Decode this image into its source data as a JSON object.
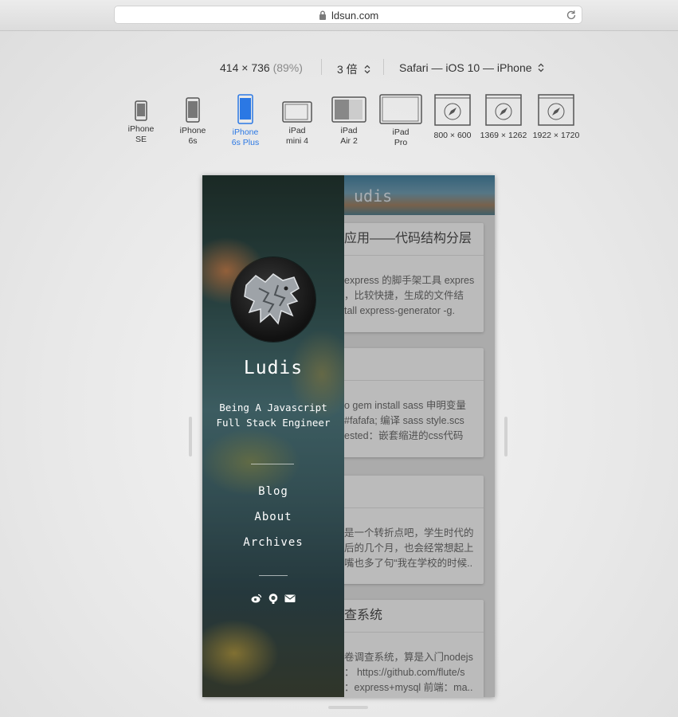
{
  "browser": {
    "url": "ldsun.com"
  },
  "responsive": {
    "dimensions": "414 × 736",
    "zoom_pct": "(89%)",
    "scale": "3 倍",
    "browser_label": "Safari — iOS 10 — iPhone",
    "devices": [
      {
        "line1": "iPhone",
        "line2": "SE",
        "icon": "phone-icon"
      },
      {
        "line1": "iPhone",
        "line2": "6s",
        "icon": "phone-icon"
      },
      {
        "line1": "iPhone",
        "line2": "6s Plus",
        "icon": "phone-icon",
        "active": true
      },
      {
        "line1": "iPad",
        "line2": "mini 4",
        "icon": "tablet-icon"
      },
      {
        "line1": "iPad",
        "line2": "Air 2",
        "icon": "tablet-icon"
      },
      {
        "line1": "iPad",
        "line2": "Pro",
        "icon": "tablet-icon"
      },
      {
        "line1": "800 × 600",
        "line2": "",
        "icon": "compass-icon"
      },
      {
        "line1": "1369 × 1262",
        "line2": "",
        "icon": "compass-icon"
      },
      {
        "line1": "1922 × 1720",
        "line2": "",
        "icon": "compass-icon"
      }
    ],
    "accent_color": "#2b78e4"
  },
  "site": {
    "header_title": "udis",
    "sidebar": {
      "name": "Ludis",
      "tagline": "Being A Javascript Full Stack Engineer",
      "nav": [
        "Blog",
        "About",
        "Archives"
      ],
      "social_icons": [
        "weibo-icon",
        "github-icon",
        "mail-icon"
      ]
    },
    "posts": [
      {
        "title": "应用——代码结构分层",
        "lines": [
          "express 的脚手架工具 expres",
          "，比较快捷，生成的文件结",
          "tall express-generator -g."
        ]
      },
      {
        "title": "",
        "lines": [
          "o gem install sass 申明变量",
          "#fafafa; 编译  sass style.scs",
          "ested：嵌套缩进的css代码"
        ]
      },
      {
        "title": "",
        "lines": [
          "是一个转折点吧，学生时代的",
          "后的几个月，也会经常想起上",
          "嘴也多了句“我在学校的时候.."
        ]
      },
      {
        "title": "查系统",
        "lines": [
          "卷调查系统，算是入门nodejs",
          "：  https://github.com/flute/s",
          "：express+mysql 前端：ma.."
        ]
      }
    ]
  }
}
